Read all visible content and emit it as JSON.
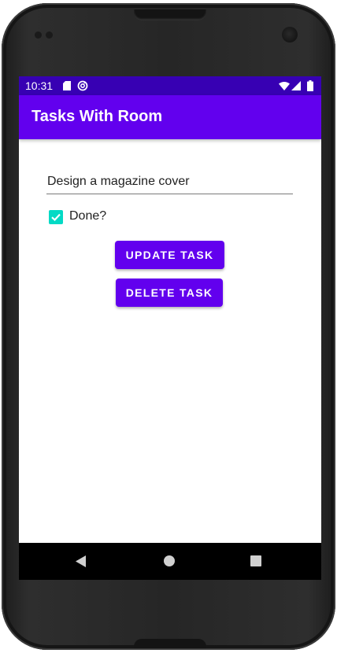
{
  "status_bar": {
    "time": "10:31",
    "icons": [
      "sd-card-icon",
      "sync-icon",
      "wifi-icon",
      "signal-icon",
      "battery-icon"
    ]
  },
  "app_bar": {
    "title": "Tasks With Room"
  },
  "form": {
    "task_value": "Design a magazine cover",
    "done_label": "Done?",
    "done_checked": true
  },
  "buttons": {
    "update_label": "UPDATE TASK",
    "delete_label": "DELETE TASK"
  },
  "nav_bar": {
    "icons": [
      "back-icon",
      "home-icon",
      "recent-apps-icon"
    ]
  },
  "colors": {
    "primary": "#6200ee",
    "primary_dark": "#3700b3",
    "accent": "#03dac5"
  }
}
